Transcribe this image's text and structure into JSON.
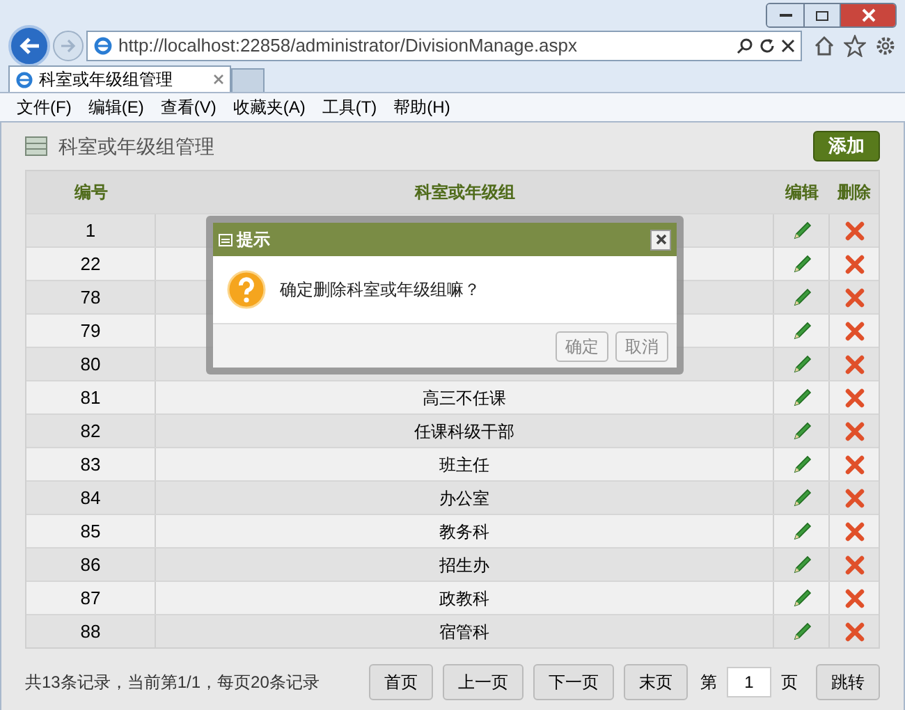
{
  "browser": {
    "address": "http://localhost:22858/administrator/DivisionManage.aspx",
    "tab_title": "科室或年级组管理"
  },
  "menu": [
    "文件(F)",
    "编辑(E)",
    "查看(V)",
    "收藏夹(A)",
    "工具(T)",
    "帮助(H)"
  ],
  "page": {
    "title": "科室或年级组管理",
    "add_button": "添加"
  },
  "table": {
    "columns": [
      "编号",
      "科室或年级组",
      "编辑",
      "删除"
    ],
    "rows": [
      {
        "id": "1"
      },
      {
        "id": "22"
      },
      {
        "id": "78"
      },
      {
        "id": "79"
      },
      {
        "id": "80"
      },
      {
        "id": "81",
        "name": "高三不任课"
      },
      {
        "id": "82",
        "name": "任课科级干部"
      },
      {
        "id": "83",
        "name": "班主任"
      },
      {
        "id": "84",
        "name": "办公室"
      },
      {
        "id": "85",
        "name": "教务科"
      },
      {
        "id": "86",
        "name": "招生办"
      },
      {
        "id": "87",
        "name": "政教科"
      },
      {
        "id": "88",
        "name": "宿管科"
      }
    ]
  },
  "pager": {
    "summary": "共13条记录，当前第1/1，每页20条记录",
    "buttons": [
      "首页",
      "上一页",
      "下一页",
      "末页"
    ],
    "page_prefix": "第",
    "page_value": "1",
    "page_suffix": "页",
    "go_button": "跳转"
  },
  "dialog": {
    "title": "提示",
    "message": "确定删除科室或年级组嘛？",
    "buttons": [
      "确定",
      "取消"
    ]
  }
}
